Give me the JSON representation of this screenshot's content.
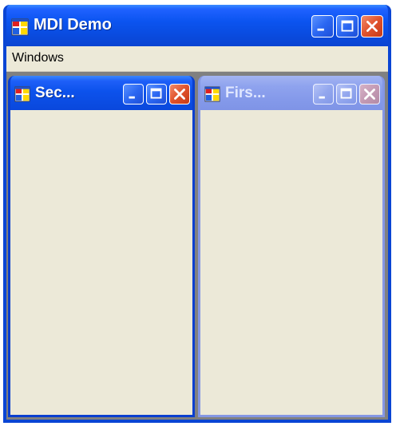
{
  "window": {
    "title": "MDI Demo",
    "app_icon": "mdi-app-icon",
    "buttons": {
      "minimize_icon": "minimize-icon",
      "maximize_icon": "maximize-icon",
      "close_icon": "close-icon"
    }
  },
  "menubar": {
    "items": [
      {
        "label": "Windows"
      }
    ]
  },
  "mdi_children": [
    {
      "title": "Sec...",
      "state": "active",
      "icon": "mdi-child-icon"
    },
    {
      "title": "Firs...",
      "state": "inactive",
      "icon": "mdi-child-icon"
    }
  ],
  "colors": {
    "titlebar_active": "#0a4ce0",
    "titlebar_inactive": "#8499ea",
    "client_background": "#ece9d8",
    "mdi_background": "#808080",
    "close_button": "#e0522c"
  }
}
